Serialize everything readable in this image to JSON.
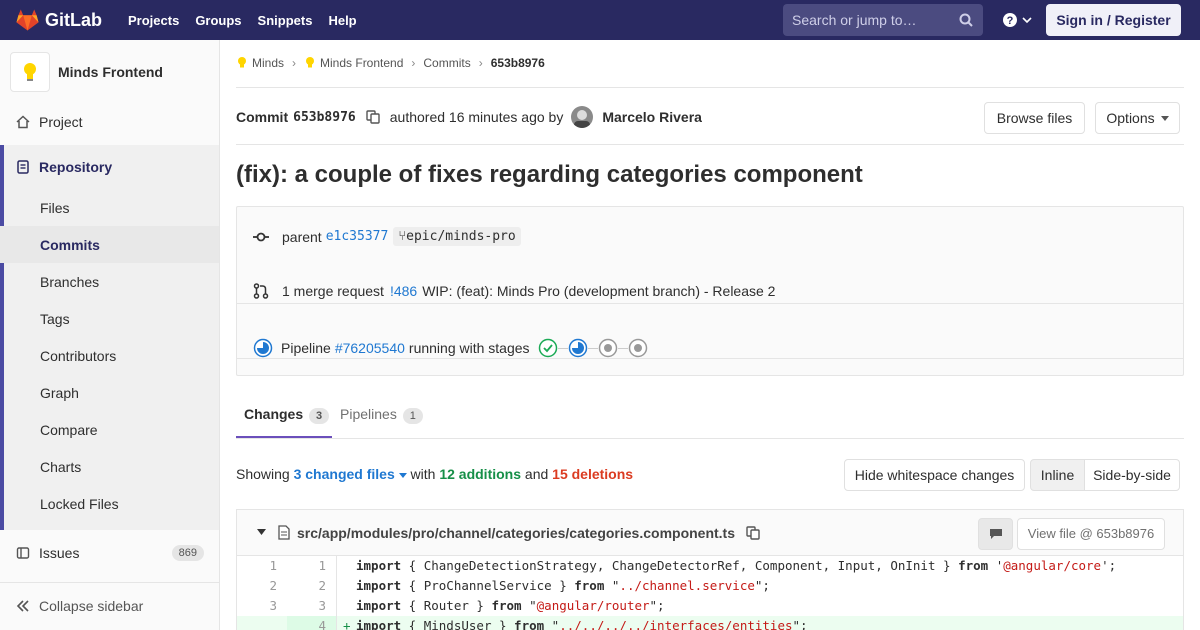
{
  "nav": {
    "brand": "GitLab",
    "links": [
      "Projects",
      "Groups",
      "Snippets",
      "Help"
    ],
    "search_placeholder": "Search or jump to…",
    "signin_label": "Sign in / Register"
  },
  "sidebar": {
    "project_name": "Minds Frontend",
    "project_label": "Project",
    "repository_label": "Repository",
    "repo_items": [
      "Files",
      "Commits",
      "Branches",
      "Tags",
      "Contributors",
      "Graph",
      "Compare",
      "Charts",
      "Locked Files"
    ],
    "issues_label": "Issues",
    "issues_count": "869",
    "collapse_label": "Collapse sidebar"
  },
  "breadcrumb": [
    "Minds",
    "Minds Frontend",
    "Commits",
    "653b8976"
  ],
  "commit": {
    "label": "Commit",
    "sha": "653b8976",
    "authored_text": "authored 16 minutes ago by",
    "author": "Marcelo Rivera",
    "browse_label": "Browse files",
    "options_label": "Options",
    "title": "(fix): a couple of fixes regarding categories component"
  },
  "info": {
    "parent_label": "parent",
    "parent_sha": "e1c35377",
    "branch": "epic/minds-pro",
    "mr_text": "1 merge request",
    "mr_id": "!486",
    "mr_title": "WIP: (feat): Minds Pro (development branch) - Release 2",
    "pipeline_label": "Pipeline",
    "pipeline_id": "#76205540",
    "pipeline_text": "running with stages"
  },
  "tabs": {
    "changes_label": "Changes",
    "changes_count": "3",
    "pipelines_label": "Pipelines",
    "pipelines_count": "1"
  },
  "diffstats": {
    "showing": "Showing",
    "changed": "3 changed files",
    "with": "with",
    "additions": "12 additions",
    "and": "and",
    "deletions": "15 deletions",
    "hide_ws_label": "Hide whitespace changes",
    "inline_label": "Inline",
    "side_label": "Side-by-side"
  },
  "file": {
    "path": "src/app/modules/pro/channel/categories/categories.component.ts",
    "view_label": "View file @ 653b8976"
  },
  "code": [
    {
      "old": "1",
      "new": "1",
      "sign": "",
      "pre": "import",
      "mid": " { ChangeDetectionStrategy, ChangeDetectorRef, Component, Input, OnInit } ",
      "kw2": "from",
      "q1": " '",
      "s": "@angular/core",
      "q2": "';"
    },
    {
      "old": "2",
      "new": "2",
      "sign": "",
      "pre": "import",
      "mid": " { ProChannelService } ",
      "kw2": "from",
      "q1": " \"",
      "s": "../channel.service",
      "q2": "\";"
    },
    {
      "old": "3",
      "new": "3",
      "sign": "",
      "pre": "import",
      "mid": " { Router } ",
      "kw2": "from",
      "q1": " \"",
      "s": "@angular/router",
      "q2": "\";"
    },
    {
      "old": "",
      "new": "4",
      "sign": "+",
      "pre": "import",
      "mid": " { MindsUser } ",
      "kw2": "from",
      "q1": " \"",
      "s": "../../../../interfaces/entities",
      "q2": "\";"
    }
  ],
  "colors": {
    "nav_bg": "#292961",
    "link": "#1f78d1",
    "additions": "#168f48",
    "deletions": "#db3b21",
    "added_line_bg": "#ecfdf0"
  }
}
